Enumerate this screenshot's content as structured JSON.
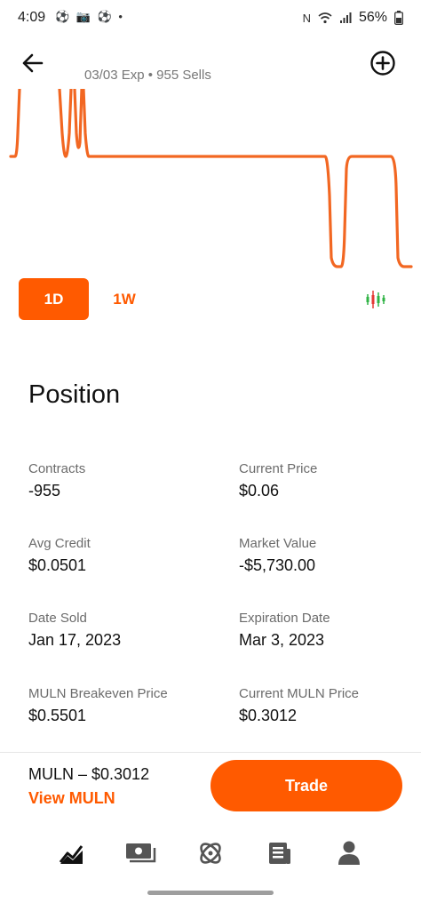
{
  "status_bar": {
    "time": "4:09",
    "left_icons": "⚽ 📷 ⚽ •",
    "battery": "56%"
  },
  "header": {
    "subtitle": "03/03 Exp • 955 Sells"
  },
  "range": {
    "day_label": "1D",
    "week_label": "1W"
  },
  "position": {
    "title": "Position",
    "contracts_label": "Contracts",
    "contracts_value": "-955",
    "current_price_label": "Current Price",
    "current_price_value": "$0.06",
    "avg_credit_label": "Avg Credit",
    "avg_credit_value": "$0.0501",
    "market_value_label": "Market Value",
    "market_value_value": "-$5,730.00",
    "date_sold_label": "Date Sold",
    "date_sold_value": "Jan 17, 2023",
    "expiration_label": "Expiration Date",
    "expiration_value": "Mar 3, 2023",
    "breakeven_label": "MULN Breakeven Price",
    "breakeven_value": "$0.5501",
    "current_underlying_label": "Current MULN Price",
    "current_underlying_value": "$0.3012"
  },
  "footer": {
    "ticker_text": "MULN – $0.3012",
    "view_link": "View MULN",
    "trade_label": "Trade"
  },
  "colors": {
    "accent": "#ff5a00",
    "line": "#f26722"
  },
  "nav": [
    "chart-icon",
    "cash-icon",
    "crypto-icon",
    "news-icon",
    "profile-icon"
  ]
}
